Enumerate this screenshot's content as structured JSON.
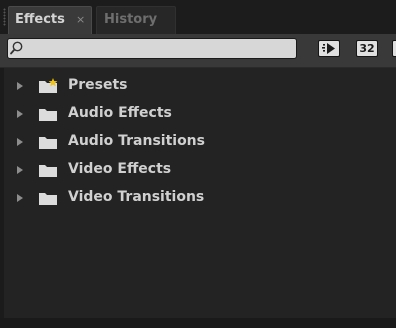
{
  "tabs": [
    {
      "label": "Effects",
      "active": true,
      "close": "×"
    },
    {
      "label": "History",
      "active": false
    }
  ],
  "search": {
    "value": "",
    "placeholder": ""
  },
  "toolbar": {
    "accelerated_effects_icon": "accelerated-effects-icon",
    "bit_depth_label": "32",
    "yuv_icon": "yuv-effects-icon"
  },
  "tree": {
    "items": [
      {
        "label": "Presets",
        "icon": "star-folder-icon"
      },
      {
        "label": "Audio Effects",
        "icon": "folder-icon"
      },
      {
        "label": "Audio Transitions",
        "icon": "folder-icon"
      },
      {
        "label": "Video Effects",
        "icon": "folder-icon"
      },
      {
        "label": "Video Transitions",
        "icon": "folder-icon"
      }
    ]
  },
  "colors": {
    "panel_bg": "#232323",
    "toolbar_bg": "#393939",
    "text": "#d0d0d0",
    "folder": "#dcdcdc",
    "star": "#f0c419"
  }
}
